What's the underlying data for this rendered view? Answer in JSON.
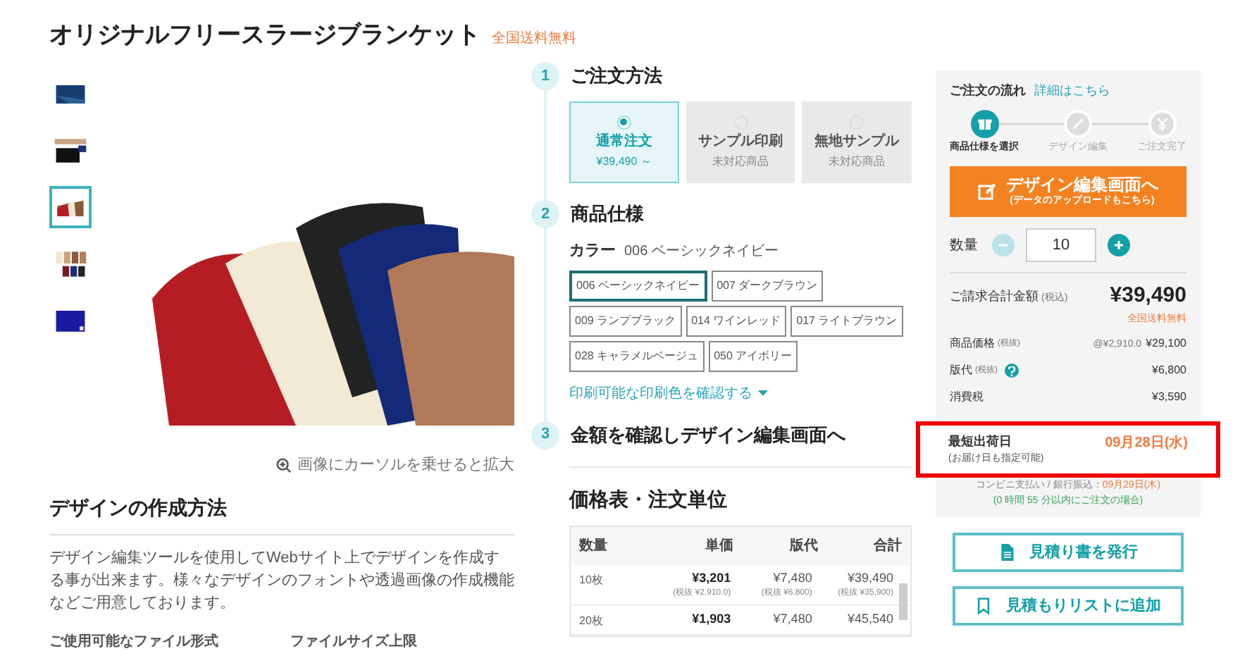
{
  "header": {
    "title": "オリジナルフリースラージブランケット",
    "badge": "全国送料無料"
  },
  "thumbnails": [
    {
      "selected": false
    },
    {
      "selected": false
    },
    {
      "selected": true
    },
    {
      "selected": false
    },
    {
      "selected": false
    }
  ],
  "zoom_hint": "画像にカーソルを乗せると拡大",
  "design_section": {
    "title": "デザインの作成方法",
    "description": "デザイン編集ツールを使用してWebサイト上でデザインを作成する事が出来ます。様々なデザインのフォントや透過画像の作成機能などご用意しております。",
    "file_formats_label": "ご使用可能なファイル形式",
    "file_size_label": "ファイルサイズ上限"
  },
  "steps": [
    {
      "number": "1",
      "title": "ご注文方法"
    },
    {
      "number": "2",
      "title": "商品仕様"
    },
    {
      "number": "3",
      "title": "金額を確認しデザイン編集画面へ"
    }
  ],
  "order_methods": [
    {
      "title": "通常注文",
      "subtitle": "¥39,490 ～",
      "selected": true
    },
    {
      "title": "サンプル印刷",
      "subtitle": "未対応商品",
      "selected": false
    },
    {
      "title": "無地サンプル",
      "subtitle": "未対応商品",
      "selected": false
    }
  ],
  "color": {
    "label": "カラー",
    "value": "006 ベーシックネイビー",
    "link": "印刷可能な印刷色を確認する",
    "options": [
      {
        "label": "006 ベーシックネイビー",
        "selected": true
      },
      {
        "label": "007 ダークブラウン",
        "selected": false
      },
      {
        "label": "009 ランプブラック",
        "selected": false
      },
      {
        "label": "014 ワインレッド",
        "selected": false
      },
      {
        "label": "017 ライトブラウン",
        "selected": false
      },
      {
        "label": "028 キャラメルベージュ",
        "selected": false
      },
      {
        "label": "050 アイボリー",
        "selected": false
      }
    ]
  },
  "price_table": {
    "title": "価格表・注文単位",
    "columns": [
      "数量",
      "単価",
      "版代",
      "合計"
    ],
    "rows": [
      {
        "quantity": "10枚",
        "unit_price": "¥3,201",
        "unit_price_note": "(税抜 ¥2,910.0)",
        "plate_fee": "¥7,480",
        "plate_fee_note": "(税抜 ¥6,800)",
        "total": "¥39,490",
        "total_note": "(税抜 ¥35,900)"
      },
      {
        "quantity": "20枚",
        "unit_price": "¥1,903",
        "plate_fee": "¥7,480",
        "total": "¥45,540"
      }
    ]
  },
  "sidebar": {
    "flow_title": "ご注文の流れ",
    "flow_link": "詳細はこちら",
    "flow_steps": [
      {
        "label": "商品仕様を選択",
        "selected": true
      },
      {
        "label": "デザイン編集",
        "selected": false
      },
      {
        "label": "ご注文完了",
        "selected": false
      }
    ],
    "edit_button": {
      "title": "デザイン編集画面へ",
      "subtitle": "(データのアップロードもこちら)"
    },
    "quantity": {
      "label": "数量",
      "value": "10"
    },
    "total": {
      "label": "ご請求合計金額",
      "tax_note": "(税込)",
      "amount": "¥39,490",
      "shipping": "全国送料無料"
    },
    "breakdown": [
      {
        "label": "商品価格",
        "note": "(税抜)",
        "unit": "@¥2,910.0",
        "amount": "¥29,100",
        "help": false
      },
      {
        "label": "版代",
        "note": "(税抜)",
        "amount": "¥6,800",
        "help": true
      },
      {
        "label": "消費税",
        "amount": "¥3,590",
        "help": false
      }
    ],
    "shipping": {
      "label": "最短出荷日",
      "note": "(お届け日も指定可能)",
      "date": "09月28日(水)",
      "alt_label": "コンビニ支払い / 銀行振込：",
      "alt_date": "09月29日(木)",
      "deadline": "(0 時間 55 分以内にご注文の場合)"
    },
    "buttons": [
      {
        "kind": "document",
        "label": "見積り書を発行"
      },
      {
        "kind": "bookmark",
        "label": "見積もりリストに追加"
      }
    ]
  }
}
